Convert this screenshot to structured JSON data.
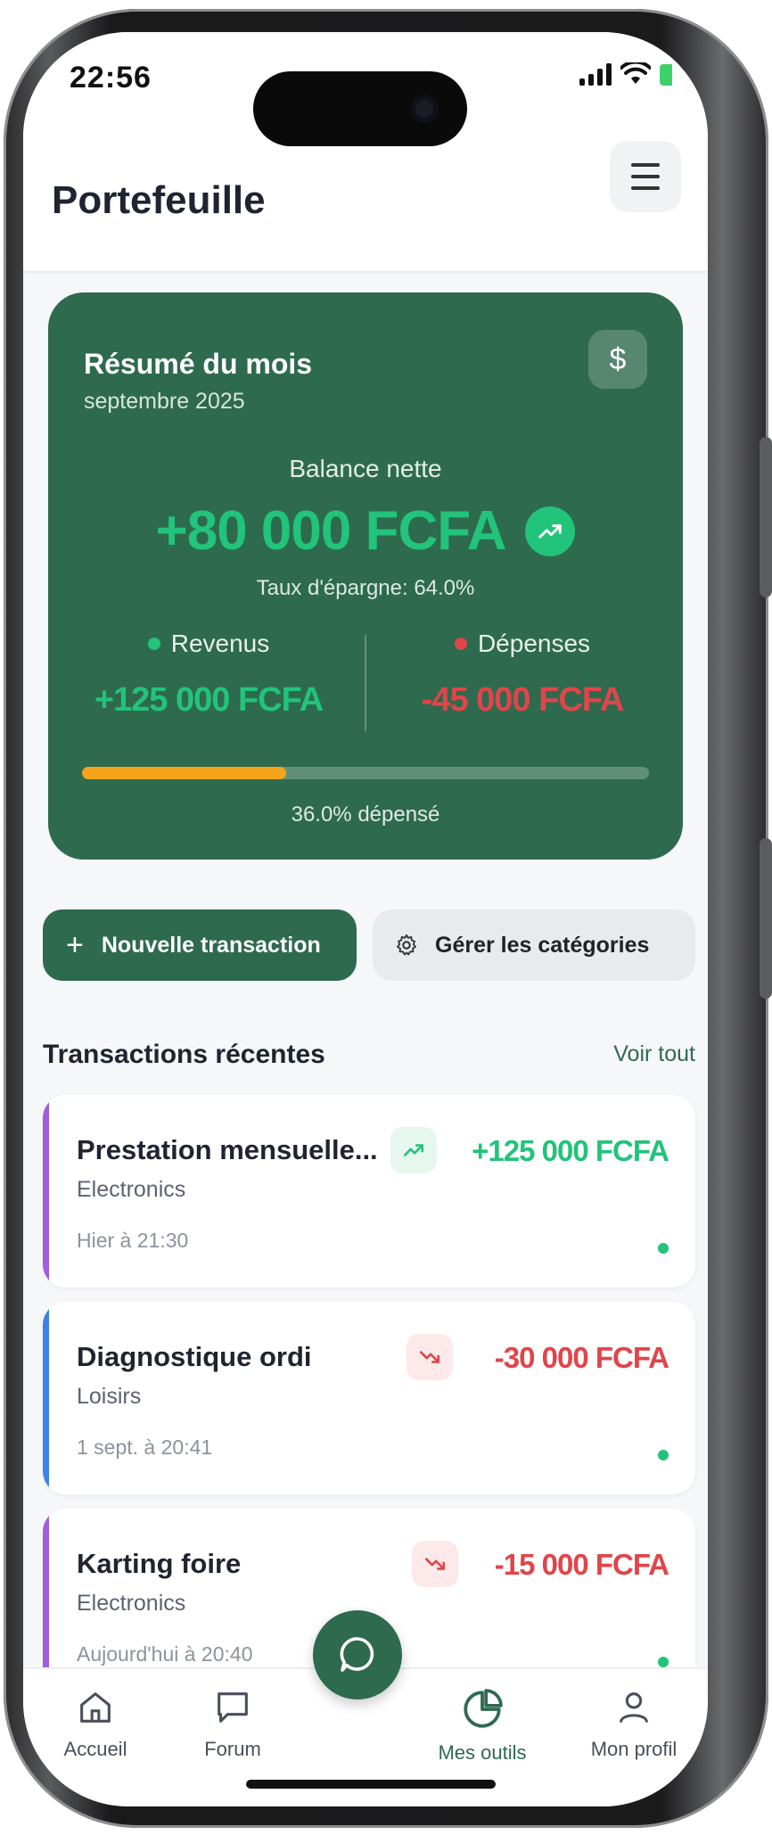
{
  "status_bar": {
    "time": "22:56"
  },
  "header": {
    "title": "Portefeuille"
  },
  "summary": {
    "title": "Résumé du mois",
    "period": "septembre 2025",
    "balance_label": "Balance nette",
    "balance_value": "+80 000 FCFA",
    "savings_rate": "Taux d'épargne: 64.0%",
    "income_label": "Revenus",
    "income_value": "+125 000 FCFA",
    "expense_label": "Dépenses",
    "expense_value": "-45 000 FCFA",
    "spent_fraction": 0.36,
    "spent_text": "36.0% dépensé"
  },
  "actions": {
    "new_transaction": "Nouvelle transaction",
    "manage_categories": "Gérer les catégories"
  },
  "transactions": {
    "title": "Transactions récentes",
    "see_all": "Voir tout",
    "items": [
      {
        "name": "Prestation mensuelle...",
        "category": "Electronics",
        "date": "Hier à 21:30",
        "amount": "+125 000 FCFA",
        "type": "income",
        "bar_color": "#a35be0"
      },
      {
        "name": "Diagnostique ordi",
        "category": "Loisirs",
        "date": "1 sept. à 20:41",
        "amount": "-30 000 FCFA",
        "type": "expense",
        "bar_color": "#3d82e8"
      },
      {
        "name": "Karting foire",
        "category": "Electronics",
        "date": "Aujourd'hui à 20:40",
        "amount": "-15 000 FCFA",
        "type": "expense",
        "bar_color": "#a35be0"
      }
    ]
  },
  "nav": {
    "home": "Accueil",
    "forum": "Forum",
    "tools": "Mes outils",
    "profile": "Mon profil"
  },
  "colors": {
    "brand_green": "#2e6a4e",
    "income_green": "#22c37a",
    "expense_red": "#e0454a",
    "progress_orange": "#f5a31a"
  }
}
